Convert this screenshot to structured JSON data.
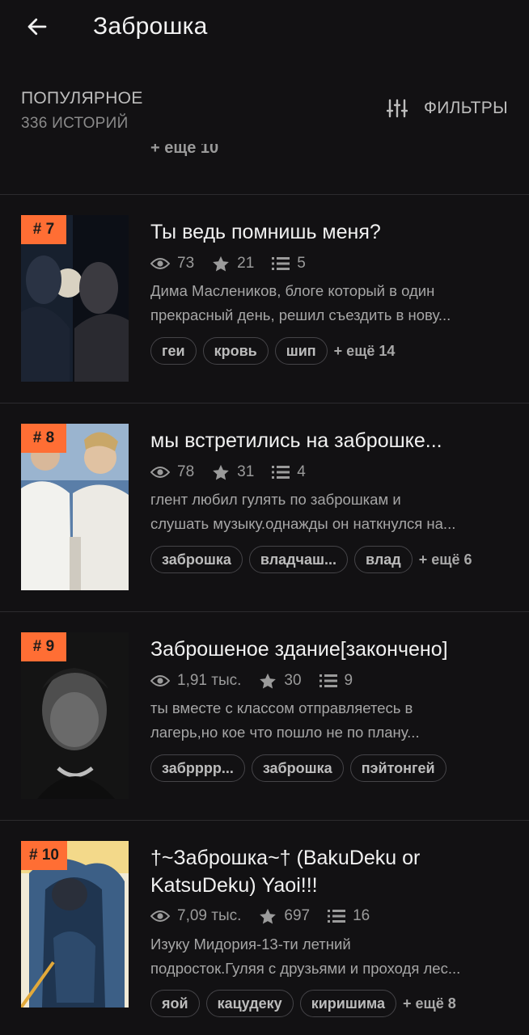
{
  "header": {
    "title": "Заброшка",
    "back_icon": "arrow-left-icon"
  },
  "sort": {
    "label": "ПОПУЛЯРНОЕ",
    "count": "336 ИСТОРИЙ",
    "filters_label": "ФИЛЬТРЫ",
    "filters_icon": "sliders-icon"
  },
  "prev_cut_text": "+ ещё 10",
  "colors": {
    "accent": "#ff6e34",
    "background": "#121113",
    "divider": "#2c2b2e"
  },
  "stories": [
    {
      "rank": "# 7",
      "title": "Ты ведь помнишь меня?",
      "views": "73",
      "stars": "21",
      "parts": "5",
      "desc1": "Дима Маслеников, блоге который в один",
      "desc2": "прекрасный день, решил съездить в нову...",
      "tags": [
        "геи",
        "кровь",
        "шип"
      ],
      "more": "+ ещё 14"
    },
    {
      "rank": "# 8",
      "title": "мы встретились на заброшке...",
      "views": "78",
      "stars": "31",
      "parts": "4",
      "desc1": "глент любил гулять по заброшкам и",
      "desc2": "слушать музыку.однажды он наткнулся на...",
      "tags": [
        "заброшка",
        "владчаш...",
        "влад"
      ],
      "more": "+ ещё 6"
    },
    {
      "rank": "# 9",
      "title": "Заброшеное здание[закончено]",
      "views": "1,91 тыс.",
      "stars": "30",
      "parts": "9",
      "desc1": "ты вместе с классом отправляетесь в",
      "desc2": "лагерь,но кое что пошло не по плану...",
      "tags": [
        "забрррр...",
        "заброшка",
        "пэйтонгей"
      ],
      "more": ""
    },
    {
      "rank": "# 10",
      "title": "†~Заброшка~† (BakuDeku or KatsuDeku) Yaoi!!!",
      "views": "7,09 тыс.",
      "stars": "697",
      "parts": "16",
      "desc1": "Изуку Мидория-13-ти летний",
      "desc2": "подросток.Гуляя с друзьями и проходя лес...",
      "tags": [
        "яой",
        "кацудеку",
        "киришима"
      ],
      "more": "+ ещё 8"
    }
  ]
}
